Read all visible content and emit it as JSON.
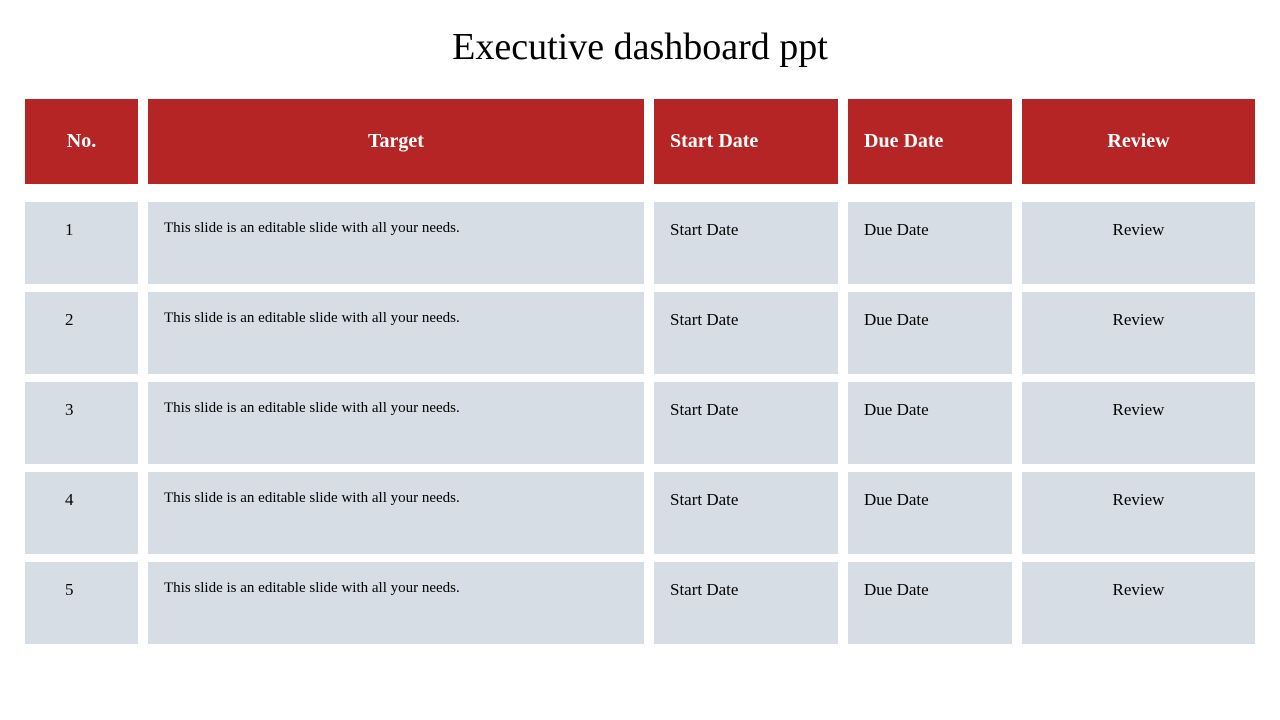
{
  "title": "Executive dashboard ppt",
  "headers": {
    "no": "No.",
    "target": "Target",
    "start": "Start  Date",
    "due": "Due Date",
    "review": "Review"
  },
  "rows": [
    {
      "no": "1",
      "target": "This slide is an editable slide with all your needs.",
      "start": "Start  Date",
      "due": "Due Date",
      "review": "Review"
    },
    {
      "no": "2",
      "target": "This slide is an editable slide with all your needs.",
      "start": "Start  Date",
      "due": "Due Date",
      "review": "Review"
    },
    {
      "no": "3",
      "target": "This slide is an editable slide with all your needs.",
      "start": "Start  Date",
      "due": "Due Date",
      "review": "Review"
    },
    {
      "no": "4",
      "target": "This slide is an editable slide with all your needs.",
      "start": "Start  Date",
      "due": "Due Date",
      "review": "Review"
    },
    {
      "no": "5",
      "target": "This slide is an editable slide with all your needs.",
      "start": "Start  Date",
      "due": "Due Date",
      "review": "Review"
    }
  ]
}
